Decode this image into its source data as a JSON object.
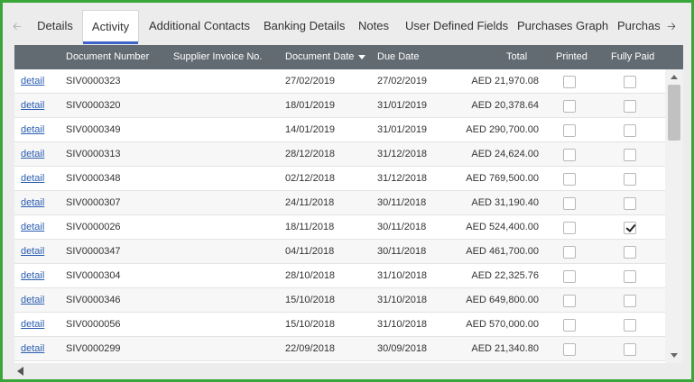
{
  "tabs": [
    {
      "label": "Details",
      "active": false
    },
    {
      "label": "Activity",
      "active": true
    },
    {
      "label": "Additional Contacts",
      "active": false
    },
    {
      "label": "Banking Details",
      "active": false
    },
    {
      "label": "Notes",
      "active": false
    },
    {
      "label": "User Defined Fields",
      "active": false
    },
    {
      "label": "Purchases Graph",
      "active": false
    },
    {
      "label": "Purchase Or",
      "active": false
    }
  ],
  "columns": {
    "document_number": "Document Number",
    "supplier_invoice": "Supplier Invoice No.",
    "document_date": "Document Date",
    "due_date": "Due Date",
    "total": "Total",
    "printed": "Printed",
    "fully_paid": "Fully Paid"
  },
  "sort": {
    "column": "document_date",
    "direction": "descending"
  },
  "rows": [
    {
      "link": "detail",
      "document_number": "SIV0000323",
      "supplier_invoice": "",
      "document_date": "27/02/2019",
      "due_date": "27/02/2019",
      "total": "AED 21,970.08",
      "printed": false,
      "fully_paid": false
    },
    {
      "link": "detail",
      "document_number": "SIV0000320",
      "supplier_invoice": "",
      "document_date": "18/01/2019",
      "due_date": "31/01/2019",
      "total": "AED 20,378.64",
      "printed": false,
      "fully_paid": false
    },
    {
      "link": "detail",
      "document_number": "SIV0000349",
      "supplier_invoice": "",
      "document_date": "14/01/2019",
      "due_date": "31/01/2019",
      "total": "AED 290,700.00",
      "printed": false,
      "fully_paid": false
    },
    {
      "link": "detail",
      "document_number": "SIV0000313",
      "supplier_invoice": "",
      "document_date": "28/12/2018",
      "due_date": "31/12/2018",
      "total": "AED 24,624.00",
      "printed": false,
      "fully_paid": false
    },
    {
      "link": "detail",
      "document_number": "SIV0000348",
      "supplier_invoice": "",
      "document_date": "02/12/2018",
      "due_date": "31/12/2018",
      "total": "AED 769,500.00",
      "printed": false,
      "fully_paid": false
    },
    {
      "link": "detail",
      "document_number": "SIV0000307",
      "supplier_invoice": "",
      "document_date": "24/11/2018",
      "due_date": "30/11/2018",
      "total": "AED 31,190.40",
      "printed": false,
      "fully_paid": false
    },
    {
      "link": "detail",
      "document_number": "SIV0000026",
      "supplier_invoice": "",
      "document_date": "18/11/2018",
      "due_date": "30/11/2018",
      "total": "AED 524,400.00",
      "printed": false,
      "fully_paid": true
    },
    {
      "link": "detail",
      "document_number": "SIV0000347",
      "supplier_invoice": "",
      "document_date": "04/11/2018",
      "due_date": "30/11/2018",
      "total": "AED 461,700.00",
      "printed": false,
      "fully_paid": false
    },
    {
      "link": "detail",
      "document_number": "SIV0000304",
      "supplier_invoice": "",
      "document_date": "28/10/2018",
      "due_date": "31/10/2018",
      "total": "AED 22,325.76",
      "printed": false,
      "fully_paid": false
    },
    {
      "link": "detail",
      "document_number": "SIV0000346",
      "supplier_invoice": "",
      "document_date": "15/10/2018",
      "due_date": "31/10/2018",
      "total": "AED 649,800.00",
      "printed": false,
      "fully_paid": false
    },
    {
      "link": "detail",
      "document_number": "SIV0000056",
      "supplier_invoice": "",
      "document_date": "15/10/2018",
      "due_date": "31/10/2018",
      "total": "AED 570,000.00",
      "printed": false,
      "fully_paid": false
    },
    {
      "link": "detail",
      "document_number": "SIV0000299",
      "supplier_invoice": "",
      "document_date": "22/09/2018",
      "due_date": "30/09/2018",
      "total": "AED 21,340.80",
      "printed": false,
      "fully_paid": false
    }
  ],
  "icons": {
    "tabs_left": "arrow-left-icon",
    "tabs_right": "arrow-right-icon",
    "sort": "sort-descending-icon",
    "scroll_up": "scroll-up-icon",
    "scroll_down": "scroll-down-icon",
    "scroll_left": "scroll-left-icon"
  },
  "colors": {
    "frame_border": "#3aa63a",
    "header_bg": "#636b72",
    "active_tab_underline": "#3a64c8",
    "link": "#2a5db0"
  }
}
